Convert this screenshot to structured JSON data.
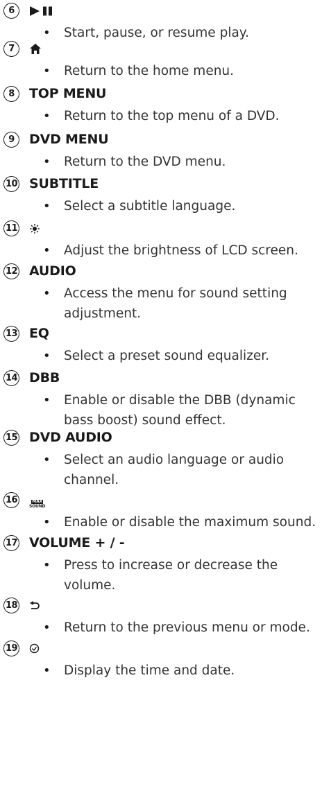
{
  "items": [
    {
      "num": "6",
      "label": "",
      "icon": "play-pause-icon",
      "desc": [
        "Start, pause, or resume play."
      ]
    },
    {
      "num": "7",
      "label": "",
      "icon": "home-icon",
      "desc": [
        "Return to the home menu."
      ]
    },
    {
      "num": "8",
      "label": "TOP MENU",
      "desc": [
        "Return to the top menu of a DVD."
      ]
    },
    {
      "num": "9",
      "label": "DVD MENU",
      "desc": [
        "Return to the DVD menu."
      ]
    },
    {
      "num": "10",
      "label": "SUBTITLE",
      "desc": [
        "Select a subtitle language."
      ]
    },
    {
      "num": "11",
      "label": "",
      "icon": "brightness-icon",
      "desc": [
        "Adjust the brightness of LCD screen."
      ]
    },
    {
      "num": "12",
      "label": "AUDIO",
      "desc": [
        "Access the menu for sound setting",
        "adjustment."
      ]
    },
    {
      "num": "13",
      "label": "EQ",
      "desc": [
        "Select a preset sound equalizer."
      ]
    },
    {
      "num": "14",
      "label": "DBB",
      "desc": [
        "Enable or disable the DBB (dynamic",
        "bass boost) sound effect."
      ]
    },
    {
      "num": "15",
      "label": "DVD AUDIO",
      "desc": [
        "Select an audio language or audio",
        "channel."
      ]
    },
    {
      "num": "16",
      "label": "",
      "icon": "max-sound-icon",
      "icon_text": [
        "MAX",
        "SOUND"
      ],
      "desc": [
        "Enable or disable the maximum sound."
      ]
    },
    {
      "num": "17",
      "label": "VOLUME + / -",
      "desc": [
        "Press to increase or decrease the",
        "volume."
      ]
    },
    {
      "num": "18",
      "label": "",
      "icon": "back-icon",
      "desc": [
        "Return to the previous menu or mode."
      ]
    },
    {
      "num": "19",
      "label": "",
      "icon": "clock-icon",
      "desc": [
        "Display the time and date."
      ]
    }
  ]
}
